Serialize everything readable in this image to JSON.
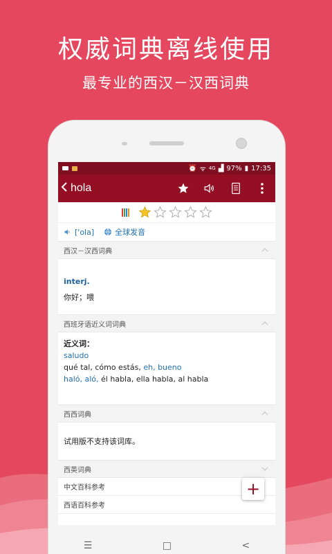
{
  "promo": {
    "title": "权威词典离线使用",
    "subtitle": "最专业的西汉－汉西词典"
  },
  "status_bar": {
    "left_icons": [
      "notification-icon",
      "app-icon"
    ],
    "right_icons": [
      "alarm-icon",
      "wifi-icon",
      "signal-icon"
    ],
    "network": "4G",
    "battery": "97%",
    "time": "17:35"
  },
  "app_bar": {
    "back_icon": "chevron-left-icon",
    "word": "hola",
    "actions": [
      "star-icon",
      "speaker-icon",
      "notes-icon",
      "more-vert-icon"
    ]
  },
  "rating": {
    "frequency_colors": [
      "#e53935",
      "#43a047",
      "#1e88e5",
      "#fb8c00"
    ],
    "stars_filled": 1,
    "stars_total": 5
  },
  "pronunciation": {
    "phonetic": "['ola]",
    "global_label": "全球发音"
  },
  "sections": {
    "s1_title": "西汉－汉西词典",
    "s1_pos": "interj.",
    "s1_meaning": "你好；喂",
    "s2_title": "西班牙语近义词词典",
    "s2_label": "近义词：",
    "s2_line1": "saludo",
    "s2_line2a": "qué tal,",
    "s2_line2b": "cómo estás,",
    "s2_line2c": "eh,",
    "s2_line2d": "bueno",
    "s2_line3a": "haló,",
    "s2_line3b": "aló,",
    "s2_line3c": "él habla,",
    "s2_line3d": "ella habla,",
    "s2_line3e": "al habla",
    "s3_title": "西西词典",
    "s3_text": "试用版不支持该词库。",
    "s4_title": "西英词典",
    "s5_title": "中文百科参考",
    "s6_title": "西语百科参考"
  },
  "fab": {
    "label": "+"
  },
  "nav_bar": {
    "menu_glyph": "☰",
    "home_glyph": "□",
    "back_glyph": "<"
  },
  "colors": {
    "background": "#E5485E",
    "app_bar": "#950f24",
    "status_bar": "#7d0f21",
    "link": "#1f6fb2"
  }
}
